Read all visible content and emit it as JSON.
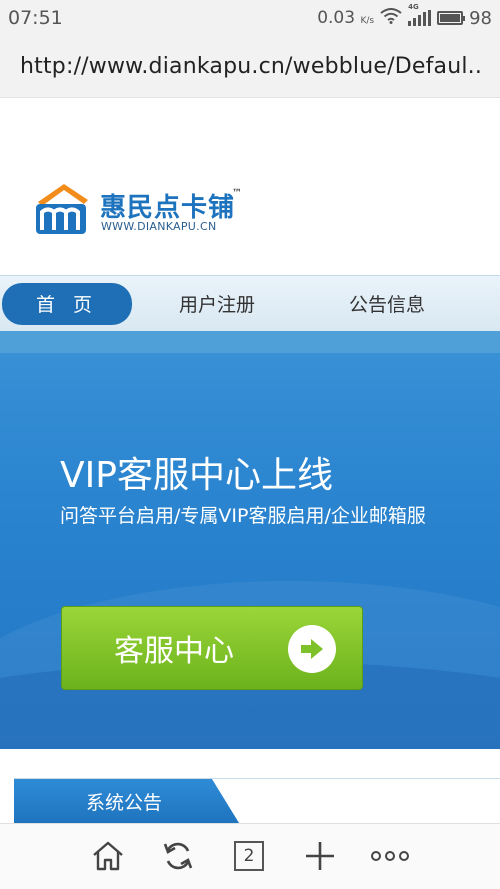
{
  "status_bar": {
    "time": "07:51",
    "network_speed": "0.03",
    "speed_unit": "K/s",
    "network_type": "4G",
    "battery_percent": "98",
    "battery_level": 0.98
  },
  "browser": {
    "url": "http://www.diankapu.cn/webblue/Defaul.."
  },
  "logo": {
    "title": "惠民点卡铺",
    "trademark": "™",
    "url": "WWW.DIANKAPU.CN",
    "icon": "m-house-logo"
  },
  "nav": {
    "items": [
      {
        "label": "首 页",
        "active": true
      },
      {
        "label": "用户注册",
        "active": false
      },
      {
        "label": "公告信息",
        "active": false
      }
    ]
  },
  "banner": {
    "title": "VIP客服中心上线",
    "subtitle": "问答平台启用/专属VIP客服启用/企业邮箱服",
    "button_label": "客服中心",
    "button_icon": "arrow-right-circle-icon"
  },
  "notice": {
    "tab_label": "系统公告"
  },
  "toolbar": {
    "tab_count": "2",
    "icons": [
      "home-icon",
      "refresh-icon",
      "tabs-icon",
      "new-tab-icon",
      "more-icon"
    ]
  },
  "colors": {
    "brand_blue": "#1e73be",
    "banner_blue": "#2a84cf",
    "cta_green": "#7cc228"
  }
}
